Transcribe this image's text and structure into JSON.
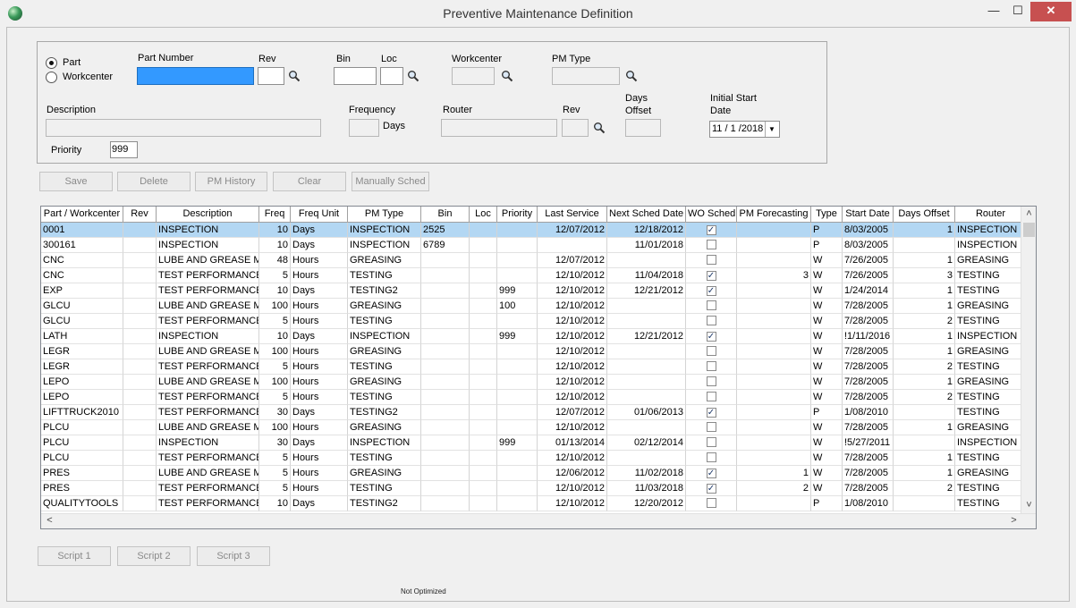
{
  "window": {
    "title": "Preventive Maintenance Definition",
    "min_glyph": "—",
    "max_glyph": "☐",
    "close_glyph": "✕"
  },
  "form": {
    "radio_part": "Part",
    "radio_workcenter": "Workcenter",
    "selected_radio": "Part",
    "part_number_label": "Part Number",
    "part_number_value": "",
    "rev_label": "Rev",
    "rev_value": "",
    "bin_label": "Bin",
    "bin_value": "",
    "loc_label": "Loc",
    "loc_value": "",
    "workcenter_label": "Workcenter",
    "workcenter_value": "",
    "pm_type_label": "PM Type",
    "pm_type_value": "",
    "description_label": "Description",
    "description_value": "",
    "frequency_label": "Frequency",
    "frequency_value": "",
    "frequency_unit": "Days",
    "router_label": "Router",
    "router_value": "",
    "router_rev_label": "Rev",
    "router_rev_value": "",
    "days_offset_label_1": "Days",
    "days_offset_label_2": "Offset",
    "days_offset_value": "",
    "initial_start_label_1": "Initial Start",
    "initial_start_label_2": "Date",
    "initial_start_value": "11 / 1 /2018",
    "priority_label": "Priority",
    "priority_value": "999"
  },
  "buttons": {
    "save": "Save",
    "delete": "Delete",
    "pm_history": "PM History",
    "clear": "Clear",
    "manually_sched": "Manually Sched",
    "script1": "Script 1",
    "script2": "Script 2",
    "script3": "Script 3"
  },
  "grid": {
    "columns": [
      "Part / Workcenter",
      "Rev",
      "Description",
      "Freq",
      "Freq Unit",
      "PM Type",
      "Bin",
      "Loc",
      "Priority",
      "Last Service",
      "Next Sched Date",
      "WO Sched",
      "PM Forecasting",
      "Type",
      "Start Date",
      "Days Offset",
      "Router"
    ],
    "selected_row": 0,
    "rows": [
      [
        "0001",
        "",
        "INSPECTION",
        "10",
        "Days",
        "INSPECTION",
        "2525",
        "",
        "",
        "12/07/2012",
        "12/18/2012",
        true,
        "",
        "P",
        "8/03/2005",
        "1",
        "INSPECTION"
      ],
      [
        "300161",
        "",
        "INSPECTION",
        "10",
        "Days",
        "INSPECTION",
        "6789",
        "",
        "",
        "",
        "11/01/2018",
        false,
        "",
        "P",
        "8/03/2005",
        "",
        "INSPECTION"
      ],
      [
        "CNC",
        "",
        "LUBE AND GREASE MA",
        "48",
        "Hours",
        "GREASING",
        "",
        "",
        "",
        "12/07/2012",
        "",
        false,
        "",
        "W",
        "7/26/2005",
        "1",
        "GREASING"
      ],
      [
        "CNC",
        "",
        "TEST PERFORMANCE C",
        "5",
        "Hours",
        "TESTING",
        "",
        "",
        "",
        "12/10/2012",
        "11/04/2018",
        true,
        "3",
        "W",
        "7/26/2005",
        "3",
        "TESTING"
      ],
      [
        "EXP",
        "",
        "TEST PERFORMANCE C",
        "10",
        "Days",
        "TESTING2",
        "",
        "",
        "999",
        "12/10/2012",
        "12/21/2012",
        true,
        "",
        "W",
        "1/24/2014",
        "1",
        "TESTING"
      ],
      [
        "GLCU",
        "",
        "LUBE AND GREASE MA",
        "100",
        "Hours",
        "GREASING",
        "",
        "",
        "100",
        "12/10/2012",
        "",
        false,
        "",
        "W",
        "7/28/2005",
        "1",
        "GREASING"
      ],
      [
        "GLCU",
        "",
        "TEST PERFORMANCE C",
        "5",
        "Hours",
        "TESTING",
        "",
        "",
        "",
        "12/10/2012",
        "",
        false,
        "",
        "W",
        "7/28/2005",
        "2",
        "TESTING"
      ],
      [
        "LATH",
        "",
        "INSPECTION",
        "10",
        "Days",
        "INSPECTION",
        "",
        "",
        "999",
        "12/10/2012",
        "12/21/2012",
        true,
        "",
        "W",
        "!1/11/2016",
        "1",
        "INSPECTION"
      ],
      [
        "LEGR",
        "",
        "LUBE AND GREASE MA",
        "100",
        "Hours",
        "GREASING",
        "",
        "",
        "",
        "12/10/2012",
        "",
        false,
        "",
        "W",
        "7/28/2005",
        "1",
        "GREASING"
      ],
      [
        "LEGR",
        "",
        "TEST PERFORMANCE C",
        "5",
        "Hours",
        "TESTING",
        "",
        "",
        "",
        "12/10/2012",
        "",
        false,
        "",
        "W",
        "7/28/2005",
        "2",
        "TESTING"
      ],
      [
        "LEPO",
        "",
        "LUBE AND GREASE MA",
        "100",
        "Hours",
        "GREASING",
        "",
        "",
        "",
        "12/10/2012",
        "",
        false,
        "",
        "W",
        "7/28/2005",
        "1",
        "GREASING"
      ],
      [
        "LEPO",
        "",
        "TEST PERFORMANCE C",
        "5",
        "Hours",
        "TESTING",
        "",
        "",
        "",
        "12/10/2012",
        "",
        false,
        "",
        "W",
        "7/28/2005",
        "2",
        "TESTING"
      ],
      [
        "LIFTTRUCK2010",
        "",
        "TEST PERFORMANCE C",
        "30",
        "Days",
        "TESTING2",
        "",
        "",
        "",
        "12/07/2012",
        "01/06/2013",
        true,
        "",
        "P",
        "1/08/2010",
        "",
        "TESTING"
      ],
      [
        "PLCU",
        "",
        "LUBE AND GREASE MA",
        "100",
        "Hours",
        "GREASING",
        "",
        "",
        "",
        "12/10/2012",
        "",
        false,
        "",
        "W",
        "7/28/2005",
        "1",
        "GREASING"
      ],
      [
        "PLCU",
        "",
        "INSPECTION",
        "30",
        "Days",
        "INSPECTION",
        "",
        "",
        "999",
        "01/13/2014",
        "02/12/2014",
        false,
        "",
        "W",
        "!5/27/2011",
        "",
        "INSPECTION"
      ],
      [
        "PLCU",
        "",
        "TEST PERFORMANCE C",
        "5",
        "Hours",
        "TESTING",
        "",
        "",
        "",
        "12/10/2012",
        "",
        false,
        "",
        "W",
        "7/28/2005",
        "1",
        "TESTING"
      ],
      [
        "PRES",
        "",
        "LUBE AND GREASE MA",
        "5",
        "Hours",
        "GREASING",
        "",
        "",
        "",
        "12/06/2012",
        "11/02/2018",
        true,
        "1",
        "W",
        "7/28/2005",
        "1",
        "GREASING"
      ],
      [
        "PRES",
        "",
        "TEST PERFORMANCE C",
        "5",
        "Hours",
        "TESTING",
        "",
        "",
        "",
        "12/10/2012",
        "11/03/2018",
        true,
        "2",
        "W",
        "7/28/2005",
        "2",
        "TESTING"
      ],
      [
        "QUALITYTOOLS",
        "",
        "TEST PERFORMANCE C",
        "10",
        "Days",
        "TESTING2",
        "",
        "",
        "",
        "12/10/2012",
        "12/20/2012",
        false,
        "",
        "P",
        "1/08/2010",
        "",
        "TESTING"
      ]
    ]
  },
  "scroll": {
    "up": "˄",
    "down": "˅",
    "left": "<",
    "right": ">"
  },
  "status": {
    "text": "Not Optimized"
  }
}
